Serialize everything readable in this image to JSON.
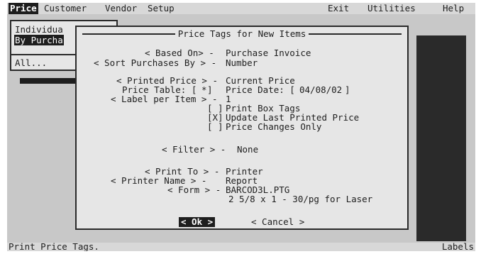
{
  "menubar": {
    "items": [
      "Price",
      "Customer",
      "Vendor",
      "Setup"
    ],
    "right_items": [
      "Exit",
      "Utilities",
      "Help"
    ]
  },
  "submenu": {
    "items": [
      "Individua",
      "By Purcha",
      "All..."
    ],
    "selected": "By Purcha"
  },
  "dialog": {
    "title": "Price Tags for New Items",
    "based_on": {
      "label": "< Based On> -",
      "value": "Purchase Invoice"
    },
    "sort_by": {
      "label": "< Sort Purchases By > -",
      "value": "Number"
    },
    "printed_price": {
      "label": "< Printed Price > -",
      "value": "Current Price"
    },
    "price_table": {
      "label": "Price Table: [",
      "value": "*",
      "close": "]"
    },
    "price_date": {
      "label": "Price Date: [",
      "value": "04/08/02",
      "close": "]"
    },
    "label_per_item": {
      "label": "< Label per Item > -",
      "value": "1"
    },
    "checkboxes": [
      {
        "mark": "[ ]",
        "label": "Print Box Tags"
      },
      {
        "mark": "[X]",
        "label": "Update Last Printed Price"
      },
      {
        "mark": "[ ]",
        "label": "Price Changes Only"
      }
    ],
    "filter": {
      "label": "< Filter > -",
      "value": "None"
    },
    "print_to": {
      "label": "< Print To > -",
      "value": "Printer"
    },
    "printer_name": {
      "label": "< Printer Name > -",
      "value": "Report"
    },
    "form": {
      "label": "< Form > -",
      "value": "BARCOD3L.PTG"
    },
    "form_desc": "2 5/8 x 1 - 30/pg for Laser",
    "ok_label": "< Ok >",
    "cancel_label": "< Cancel >"
  },
  "status": {
    "left": "Print Price Tags.",
    "right": "Labels"
  },
  "colors": {
    "screen": "#c8c8c8",
    "dialog": "#e6e6e6",
    "ink": "#1e1e1e"
  }
}
